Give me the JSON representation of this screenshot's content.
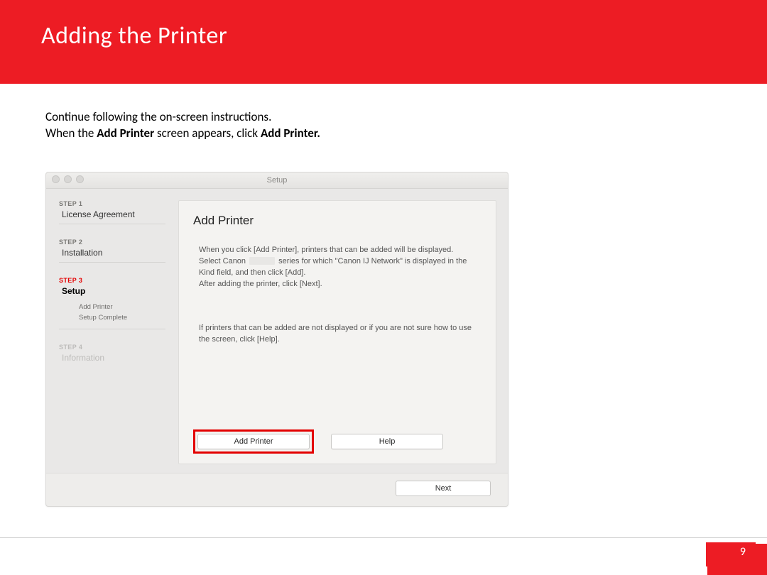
{
  "header": {
    "title": "Adding  the Printer"
  },
  "intro": {
    "line1": "Continue following the on-screen instructions.",
    "line2_pre": "When the ",
    "line2_bold1": "Add Printer",
    "line2_mid": " screen appears, click ",
    "line2_bold2": "Add Printer."
  },
  "window": {
    "title": "Setup",
    "sidebar": {
      "step1_label": "STEP 1",
      "step1_title": "License Agreement",
      "step2_label": "STEP 2",
      "step2_title": "Installation",
      "step3_label": "STEP 3",
      "step3_title": "Setup",
      "step3_sub1": "Add Printer",
      "step3_sub2": "Setup Complete",
      "step4_label": "STEP 4",
      "step4_title": "Information"
    },
    "content": {
      "heading": "Add Printer",
      "p1a": "When you click [Add Printer], printers that can be added will be displayed. Select Canon ",
      "p1b": " series for which \"Canon IJ Network\" is displayed in the Kind field, and then click [Add].",
      "p1c": "After adding the printer, click [Next].",
      "p2": "If printers that can be added are not displayed or if you are not sure how to use the screen, click [Help].",
      "btn_add": "Add Printer",
      "btn_help": "Help",
      "btn_next": "Next"
    }
  },
  "page_number": "9"
}
